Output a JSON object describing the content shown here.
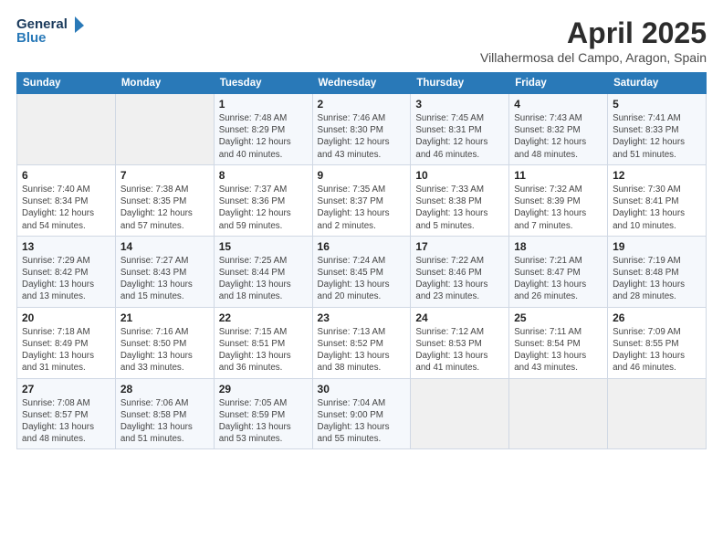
{
  "logo": {
    "line1": "General",
    "line2": "Blue"
  },
  "title": "April 2025",
  "subtitle": "Villahermosa del Campo, Aragon, Spain",
  "days_of_week": [
    "Sunday",
    "Monday",
    "Tuesday",
    "Wednesday",
    "Thursday",
    "Friday",
    "Saturday"
  ],
  "weeks": [
    [
      {
        "day": "",
        "info": ""
      },
      {
        "day": "",
        "info": ""
      },
      {
        "day": "1",
        "info": "Sunrise: 7:48 AM\nSunset: 8:29 PM\nDaylight: 12 hours and 40 minutes."
      },
      {
        "day": "2",
        "info": "Sunrise: 7:46 AM\nSunset: 8:30 PM\nDaylight: 12 hours and 43 minutes."
      },
      {
        "day": "3",
        "info": "Sunrise: 7:45 AM\nSunset: 8:31 PM\nDaylight: 12 hours and 46 minutes."
      },
      {
        "day": "4",
        "info": "Sunrise: 7:43 AM\nSunset: 8:32 PM\nDaylight: 12 hours and 48 minutes."
      },
      {
        "day": "5",
        "info": "Sunrise: 7:41 AM\nSunset: 8:33 PM\nDaylight: 12 hours and 51 minutes."
      }
    ],
    [
      {
        "day": "6",
        "info": "Sunrise: 7:40 AM\nSunset: 8:34 PM\nDaylight: 12 hours and 54 minutes."
      },
      {
        "day": "7",
        "info": "Sunrise: 7:38 AM\nSunset: 8:35 PM\nDaylight: 12 hours and 57 minutes."
      },
      {
        "day": "8",
        "info": "Sunrise: 7:37 AM\nSunset: 8:36 PM\nDaylight: 12 hours and 59 minutes."
      },
      {
        "day": "9",
        "info": "Sunrise: 7:35 AM\nSunset: 8:37 PM\nDaylight: 13 hours and 2 minutes."
      },
      {
        "day": "10",
        "info": "Sunrise: 7:33 AM\nSunset: 8:38 PM\nDaylight: 13 hours and 5 minutes."
      },
      {
        "day": "11",
        "info": "Sunrise: 7:32 AM\nSunset: 8:39 PM\nDaylight: 13 hours and 7 minutes."
      },
      {
        "day": "12",
        "info": "Sunrise: 7:30 AM\nSunset: 8:41 PM\nDaylight: 13 hours and 10 minutes."
      }
    ],
    [
      {
        "day": "13",
        "info": "Sunrise: 7:29 AM\nSunset: 8:42 PM\nDaylight: 13 hours and 13 minutes."
      },
      {
        "day": "14",
        "info": "Sunrise: 7:27 AM\nSunset: 8:43 PM\nDaylight: 13 hours and 15 minutes."
      },
      {
        "day": "15",
        "info": "Sunrise: 7:25 AM\nSunset: 8:44 PM\nDaylight: 13 hours and 18 minutes."
      },
      {
        "day": "16",
        "info": "Sunrise: 7:24 AM\nSunset: 8:45 PM\nDaylight: 13 hours and 20 minutes."
      },
      {
        "day": "17",
        "info": "Sunrise: 7:22 AM\nSunset: 8:46 PM\nDaylight: 13 hours and 23 minutes."
      },
      {
        "day": "18",
        "info": "Sunrise: 7:21 AM\nSunset: 8:47 PM\nDaylight: 13 hours and 26 minutes."
      },
      {
        "day": "19",
        "info": "Sunrise: 7:19 AM\nSunset: 8:48 PM\nDaylight: 13 hours and 28 minutes."
      }
    ],
    [
      {
        "day": "20",
        "info": "Sunrise: 7:18 AM\nSunset: 8:49 PM\nDaylight: 13 hours and 31 minutes."
      },
      {
        "day": "21",
        "info": "Sunrise: 7:16 AM\nSunset: 8:50 PM\nDaylight: 13 hours and 33 minutes."
      },
      {
        "day": "22",
        "info": "Sunrise: 7:15 AM\nSunset: 8:51 PM\nDaylight: 13 hours and 36 minutes."
      },
      {
        "day": "23",
        "info": "Sunrise: 7:13 AM\nSunset: 8:52 PM\nDaylight: 13 hours and 38 minutes."
      },
      {
        "day": "24",
        "info": "Sunrise: 7:12 AM\nSunset: 8:53 PM\nDaylight: 13 hours and 41 minutes."
      },
      {
        "day": "25",
        "info": "Sunrise: 7:11 AM\nSunset: 8:54 PM\nDaylight: 13 hours and 43 minutes."
      },
      {
        "day": "26",
        "info": "Sunrise: 7:09 AM\nSunset: 8:55 PM\nDaylight: 13 hours and 46 minutes."
      }
    ],
    [
      {
        "day": "27",
        "info": "Sunrise: 7:08 AM\nSunset: 8:57 PM\nDaylight: 13 hours and 48 minutes."
      },
      {
        "day": "28",
        "info": "Sunrise: 7:06 AM\nSunset: 8:58 PM\nDaylight: 13 hours and 51 minutes."
      },
      {
        "day": "29",
        "info": "Sunrise: 7:05 AM\nSunset: 8:59 PM\nDaylight: 13 hours and 53 minutes."
      },
      {
        "day": "30",
        "info": "Sunrise: 7:04 AM\nSunset: 9:00 PM\nDaylight: 13 hours and 55 minutes."
      },
      {
        "day": "",
        "info": ""
      },
      {
        "day": "",
        "info": ""
      },
      {
        "day": "",
        "info": ""
      }
    ]
  ]
}
